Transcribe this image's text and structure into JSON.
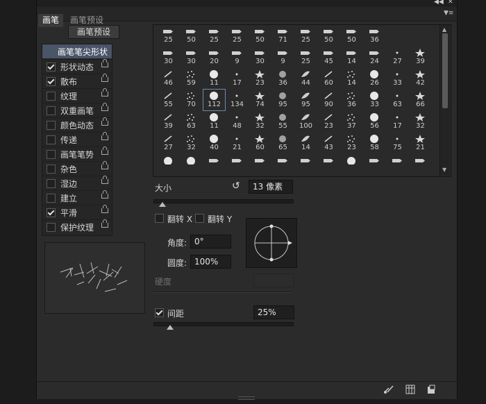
{
  "tabs": [
    {
      "label": "画笔"
    },
    {
      "label": "画笔预设"
    }
  ],
  "window_controls": {
    "collapse_icon": "double-left-arrow",
    "menu_icon": "panel-menu"
  },
  "preset_button": {
    "label": "画笔预设"
  },
  "tip_shape_header": {
    "label": "画笔笔尖形状"
  },
  "options": [
    {
      "label": "形状动态",
      "checked": true
    },
    {
      "label": "散布",
      "checked": true
    },
    {
      "label": "纹理",
      "checked": false
    },
    {
      "label": "双重画笔",
      "checked": false
    },
    {
      "label": "颜色动态",
      "checked": false
    },
    {
      "label": "传递",
      "checked": false
    },
    {
      "label": "画笔笔势",
      "checked": false
    },
    {
      "label": "杂色",
      "checked": false
    },
    {
      "label": "湿边",
      "checked": false
    },
    {
      "label": "建立",
      "checked": false
    },
    {
      "label": "平滑",
      "checked": true
    },
    {
      "label": "保护纹理",
      "checked": false
    }
  ],
  "brush_sizes": [
    [
      "25",
      "50",
      "25",
      "25",
      "50",
      "71",
      "25",
      "50",
      "50",
      "36"
    ],
    [
      "30",
      "30",
      "20",
      "9",
      "30",
      "9",
      "25",
      "45",
      "14",
      "24",
      "27",
      "39"
    ],
    [
      "46",
      "59",
      "11",
      "17",
      "23",
      "36",
      "44",
      "60",
      "14",
      "26",
      "33",
      "42"
    ],
    [
      "55",
      "70",
      "112",
      "134",
      "74",
      "95",
      "95",
      "90",
      "36",
      "33",
      "63",
      "66"
    ],
    [
      "39",
      "63",
      "11",
      "48",
      "32",
      "55",
      "100",
      "23",
      "37",
      "56",
      "17",
      "32"
    ],
    [
      "27",
      "32",
      "40",
      "21",
      "60",
      "65",
      "14",
      "43",
      "23",
      "58",
      "75",
      "21"
    ]
  ],
  "selected_brush": "112",
  "size": {
    "label": "大小",
    "value": "13 像素"
  },
  "flip": {
    "x_label": "翻转 X",
    "y_label": "翻转 Y"
  },
  "angle": {
    "label": "角度:",
    "value": "0°"
  },
  "roundness": {
    "label": "圆度:",
    "value": "100%"
  },
  "hardness": {
    "label": "硬度"
  },
  "spacing": {
    "label": "间距",
    "value": "25%",
    "checked": true
  },
  "footer_icons": [
    "toggle-brush-icon",
    "grid-icon",
    "new-preset-icon"
  ]
}
